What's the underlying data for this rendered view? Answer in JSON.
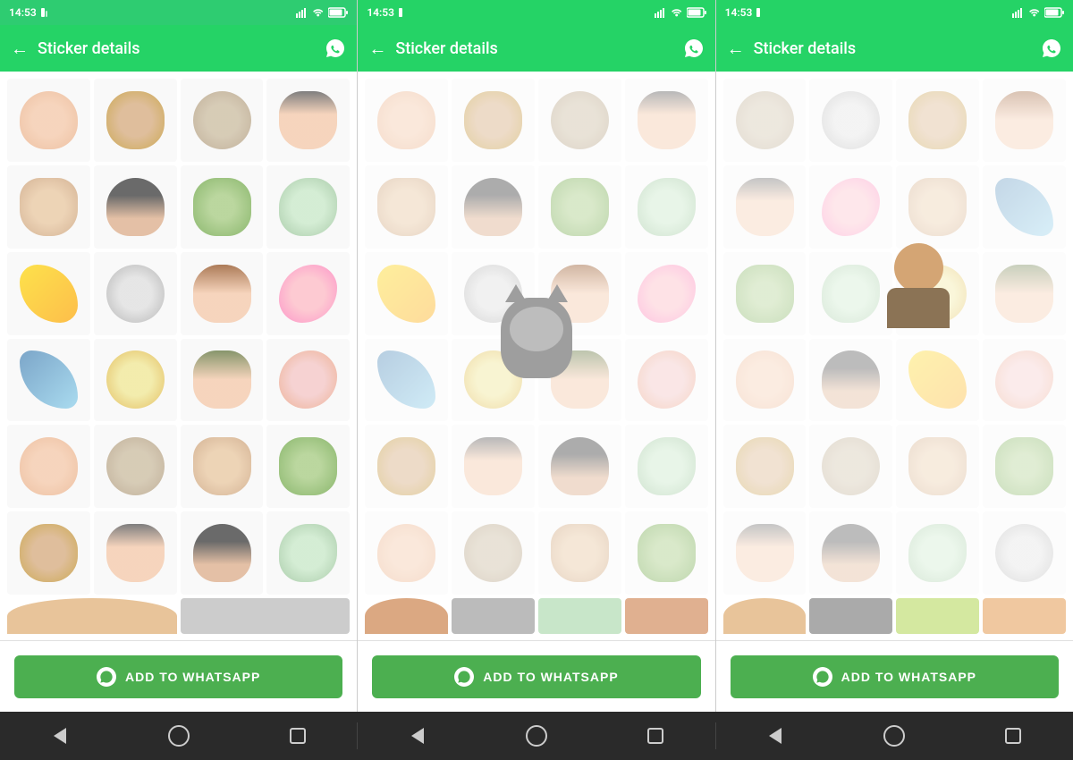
{
  "screens": [
    {
      "id": "screen1",
      "statusbar": {
        "time": "14:53",
        "icons": [
          "signal",
          "wifi",
          "battery"
        ]
      },
      "topbar": {
        "back_label": "←",
        "title": "Sticker details",
        "whatsapp_icon": "⊕"
      },
      "button": {
        "label": "ADD TO WHATSAPP",
        "icon": "whatsapp"
      },
      "stickers": [
        "sc-a",
        "sc-b",
        "sc-c",
        "sc-d",
        "sc-e",
        "sc-f",
        "sc-g",
        "sc-h",
        "sc-i",
        "sc-j",
        "sc-k",
        "sc-l",
        "sc-m",
        "sc-n",
        "sc-o",
        "sc-p",
        "sc-a",
        "sc-c",
        "sc-e",
        "sc-g",
        "sc-b",
        "sc-d",
        "sc-f",
        "sc-h",
        "sc-i",
        "sc-k",
        "sc-m",
        "sc-o"
      ]
    },
    {
      "id": "screen2",
      "statusbar": {
        "time": "14:53"
      },
      "topbar": {
        "title": "Sticker details"
      },
      "button": {
        "label": "ADD TO WHATSAPP"
      },
      "stickers": [
        "sc-a",
        "sc-b",
        "sc-c",
        "sc-d",
        "sc-e",
        "sc-f",
        "sc-g",
        "sc-h",
        "sc-i",
        "sc-j",
        "sc-k",
        "sc-l",
        "sc-m",
        "sc-n",
        "sc-o",
        "sc-p",
        "sc-b",
        "sc-d",
        "sc-f",
        "sc-h",
        "sc-a",
        "sc-c",
        "sc-e",
        "sc-g",
        "sc-j",
        "sc-l",
        "sc-n",
        "sc-p"
      ]
    },
    {
      "id": "screen3",
      "statusbar": {
        "time": "14:53"
      },
      "topbar": {
        "title": "Sticker details"
      },
      "button": {
        "label": "ADD TO WHATSAPP"
      },
      "stickers": [
        "sc-c",
        "sc-j",
        "sc-b",
        "sc-k",
        "sc-d",
        "sc-l",
        "sc-e",
        "sc-m",
        "sc-g",
        "sc-h",
        "sc-n",
        "sc-o",
        "sc-a",
        "sc-f",
        "sc-i",
        "sc-p",
        "sc-b",
        "sc-c",
        "sc-e",
        "sc-g",
        "sc-d",
        "sc-f",
        "sc-h",
        "sc-j",
        "sc-k",
        "sc-l",
        "sc-m",
        "sc-n"
      ]
    }
  ],
  "navbar": {
    "sections": [
      {
        "back": "◄",
        "home": "●",
        "square": "■"
      },
      {
        "back": "◄",
        "home": "●",
        "square": "■"
      },
      {
        "back": "◄",
        "home": "●",
        "square": "■"
      }
    ]
  },
  "colors": {
    "header_bg": "#25d366",
    "button_bg": "#4caf50",
    "nav_bg": "#2a2a2a",
    "text_white": "#ffffff"
  }
}
